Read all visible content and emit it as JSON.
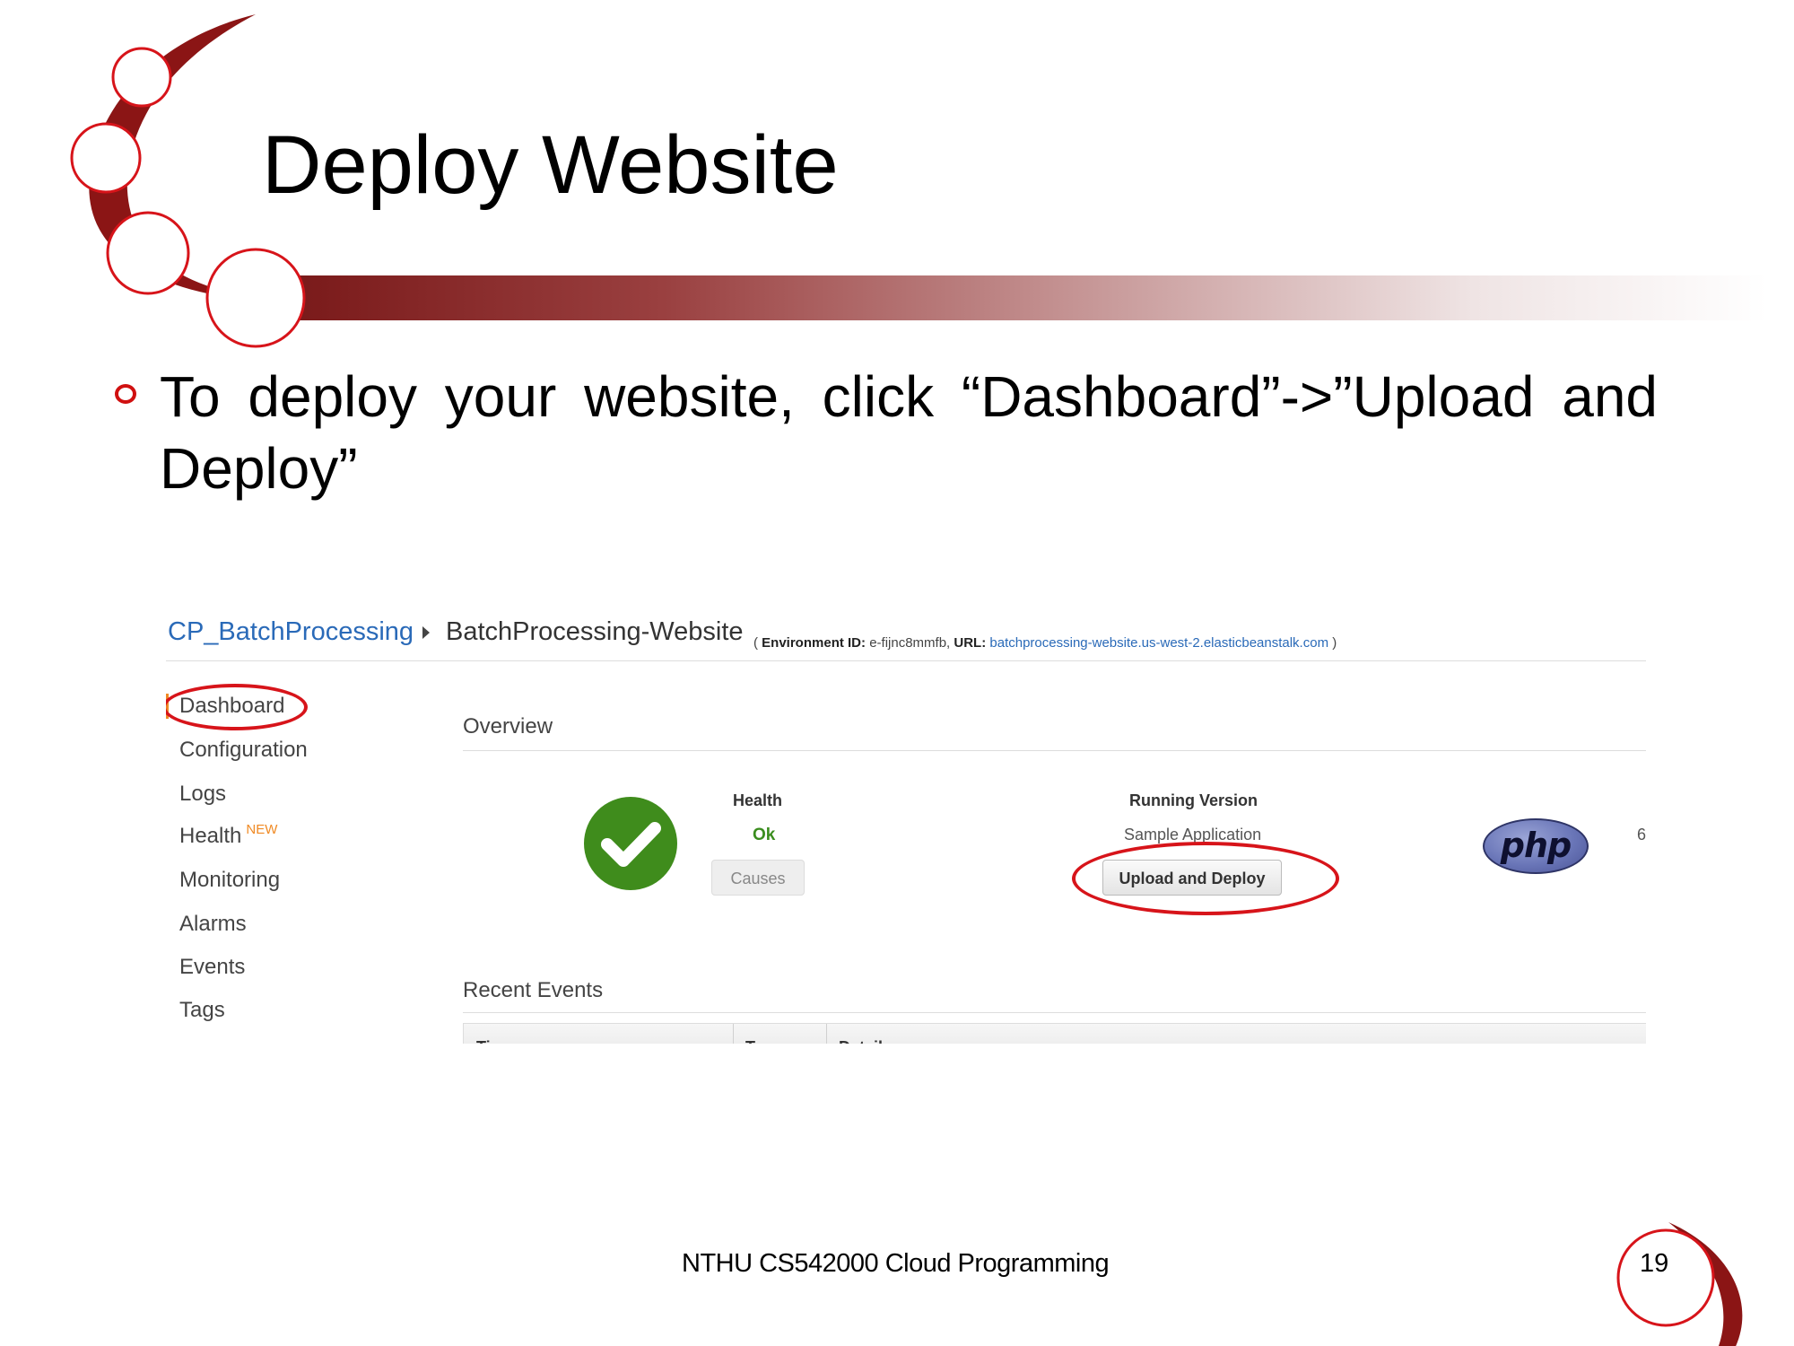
{
  "slide": {
    "title": "Deploy Website",
    "bullet": "To deploy your website, click “Dashboard”->”Upload and Deploy”",
    "footer": "NTHU CS542000 Cloud Programming",
    "page_number": "19"
  },
  "screenshot": {
    "breadcrumb": {
      "application": "CP_BatchProcessing",
      "environment": "BatchProcessing-Website",
      "env_id_label": "Environment ID:",
      "env_id": "e-fijnc8mmfb,",
      "url_label": "URL:",
      "url": "batchprocessing-website.us-west-2.elasticbeanstalk.com"
    },
    "nav": {
      "items": [
        "Dashboard",
        "Configuration",
        "Logs",
        "Health",
        "Monitoring",
        "Alarms",
        "Events",
        "Tags"
      ],
      "health_badge": "NEW",
      "active": "Dashboard"
    },
    "overview": {
      "heading": "Overview",
      "health_label": "Health",
      "health_status": "Ok",
      "causes_button": "Causes",
      "running_version_label": "Running Version",
      "running_version": "Sample Application",
      "upload_button": "Upload and Deploy",
      "platform_logo_text": "php",
      "truncated_value": "6"
    },
    "recent_events": {
      "heading": "Recent Events",
      "columns": [
        "Time",
        "Type",
        "Details"
      ]
    }
  },
  "colors": {
    "accent_red": "#d7141a",
    "link_blue": "#2a6ab8",
    "health_green": "#3f8c1c",
    "badge_orange": "#f08a24"
  }
}
